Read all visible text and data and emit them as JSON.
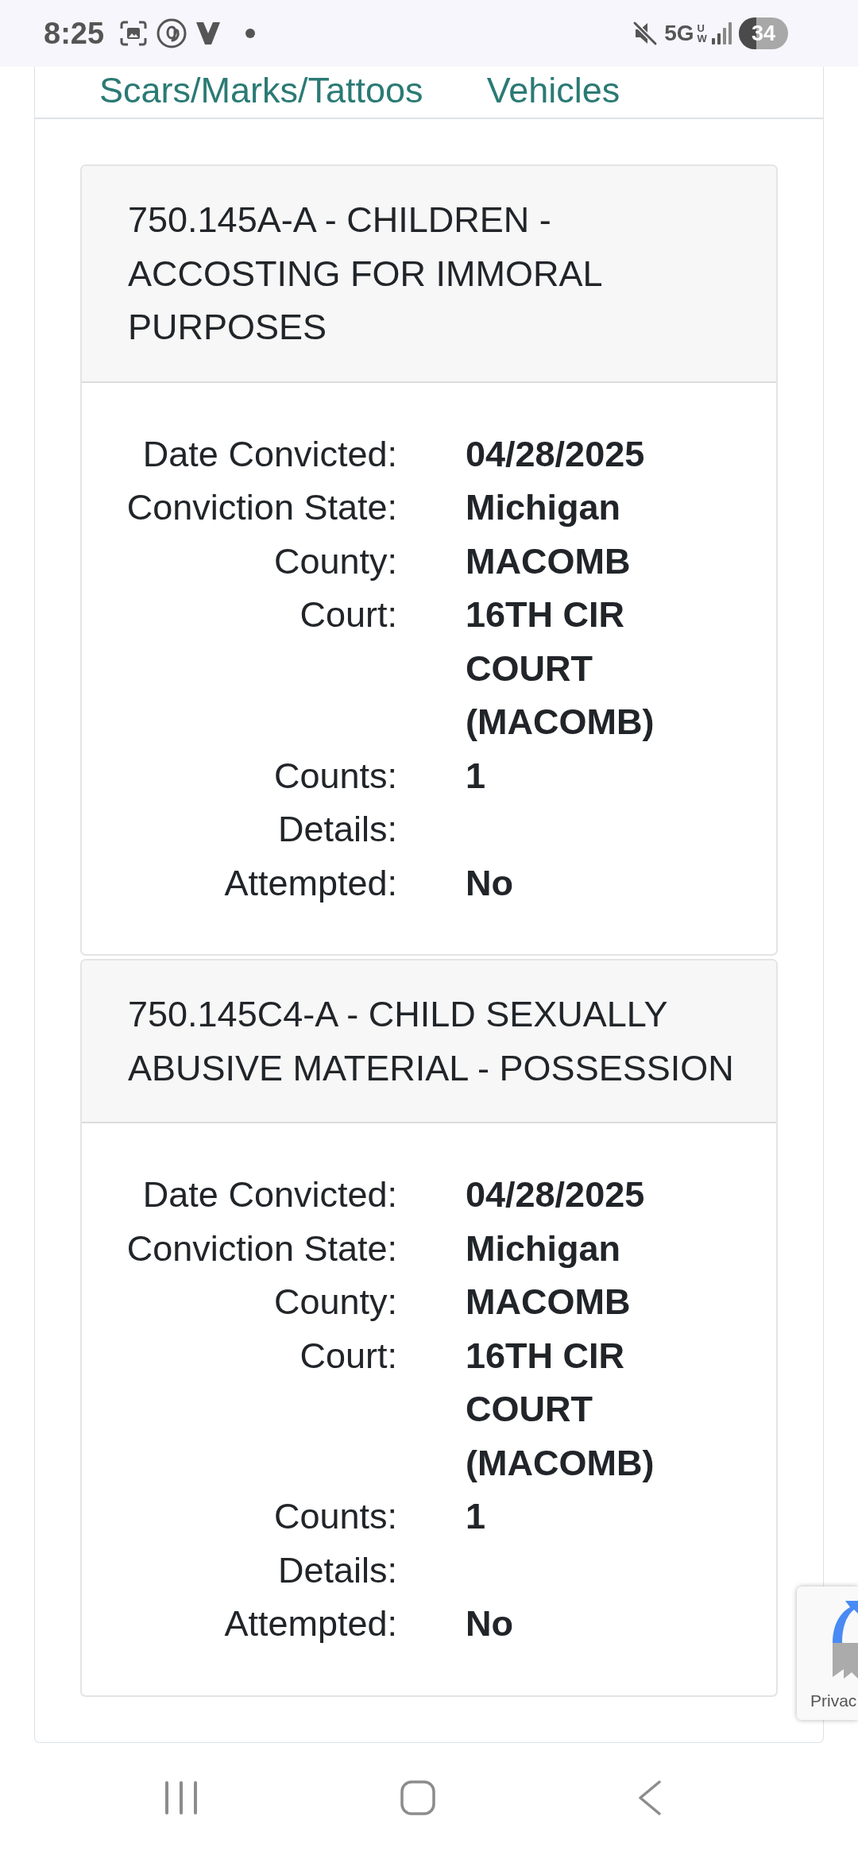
{
  "status_bar": {
    "time": "8:25",
    "network": "5G",
    "network_band": "UW",
    "battery": "34"
  },
  "section_links": [
    {
      "label": "Scars/Marks/Tattoos"
    },
    {
      "label": "Vehicles"
    }
  ],
  "offenses": [
    {
      "title": "750.145A-A - CHILDREN - ACCOSTING FOR IMMORAL PURPOSES",
      "fields": [
        {
          "label": "Date Convicted:",
          "value": "04/28/2025"
        },
        {
          "label": "Conviction State:",
          "value": "Michigan"
        },
        {
          "label": "County:",
          "value": "MACOMB"
        },
        {
          "label": "Court:",
          "value": "16TH CIR COURT (MACOMB)"
        },
        {
          "label": "Counts:",
          "value": "1"
        },
        {
          "label": "Details:"
        },
        {
          "label": "Attempted:",
          "value": "No"
        }
      ]
    },
    {
      "title": "750.145C4-A - CHILD SEXUALLY ABUSIVE MATERIAL - POSSESSION",
      "fields": [
        {
          "label": "Date Convicted:",
          "value": "04/28/2025"
        },
        {
          "label": "Conviction State:",
          "value": "Michigan"
        },
        {
          "label": "County:",
          "value": "MACOMB"
        },
        {
          "label": "Court:",
          "value": "16TH CIR COURT (MACOMB)"
        },
        {
          "label": "Counts:",
          "value": "1"
        },
        {
          "label": "Details:"
        },
        {
          "label": "Attempted:",
          "value": "No"
        }
      ]
    }
  ],
  "privacy_badge": {
    "link": "Privac"
  }
}
